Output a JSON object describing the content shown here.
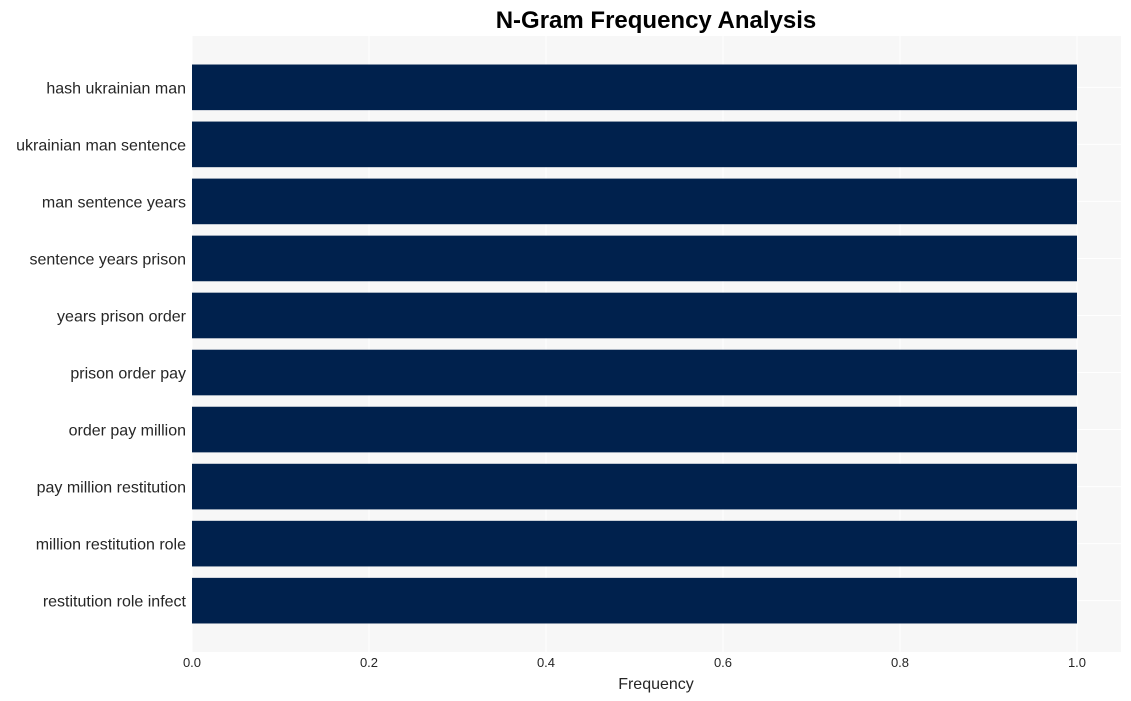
{
  "chart_data": {
    "type": "bar",
    "orientation": "horizontal",
    "title": "N-Gram Frequency Analysis",
    "xlabel": "Frequency",
    "ylabel": "",
    "categories": [
      "hash ukrainian man",
      "ukrainian man sentence",
      "man sentence years",
      "sentence years prison",
      "years prison order",
      "prison order pay",
      "order pay million",
      "pay million restitution",
      "million restitution role",
      "restitution role infect"
    ],
    "values": [
      1,
      1,
      1,
      1,
      1,
      1,
      1,
      1,
      1,
      1
    ],
    "xlim": [
      0,
      1.05
    ],
    "xticks": [
      0.0,
      0.2,
      0.4,
      0.6,
      0.8,
      1.0
    ],
    "xtick_labels": [
      "0.0",
      "0.2",
      "0.4",
      "0.6",
      "0.8",
      "1.0"
    ],
    "grid": true,
    "legend": "none",
    "colors": {
      "bar": "#00214d",
      "plot_background": "#f7f7f7",
      "grid": "#ffffff"
    }
  }
}
